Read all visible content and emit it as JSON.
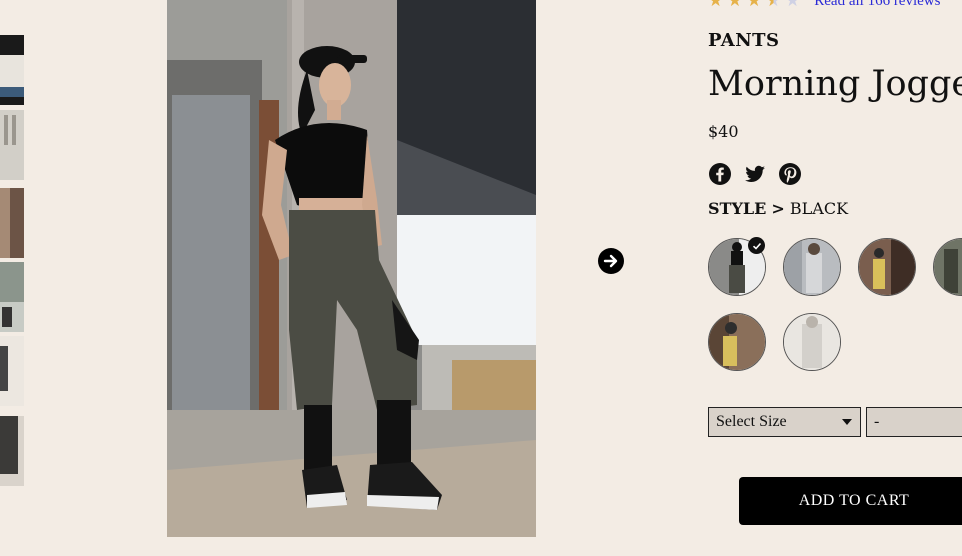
{
  "product": {
    "category": "PANTS",
    "title": "Morning Joggers",
    "price": "$40"
  },
  "rating": {
    "value": 3.5,
    "max": 5,
    "reviews_link": "Read all 166 reviews"
  },
  "share": {
    "icons": [
      "facebook-icon",
      "twitter-icon",
      "pinterest-icon"
    ]
  },
  "style": {
    "label": "STYLE",
    "separator": ">",
    "value": "BLACK",
    "selected_index": 0
  },
  "size_select": {
    "placeholder": "Select Size"
  },
  "quantity_select": {
    "value": "-"
  },
  "cart": {
    "button_label": "ADD TO CART"
  },
  "colors": {
    "background": "#f3ece4",
    "button": "#000000",
    "link": "#2b2bd6",
    "star": "#e6b24a"
  }
}
